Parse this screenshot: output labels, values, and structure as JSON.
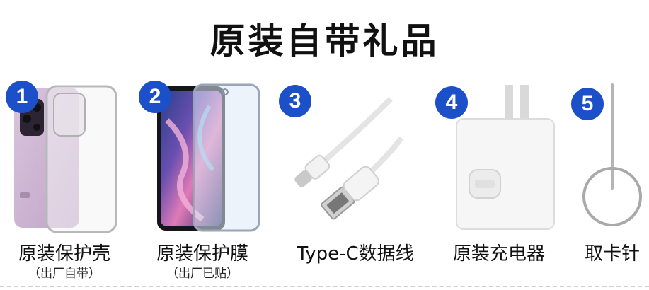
{
  "title": "原装自带礼品",
  "colors": {
    "badge": "#1b50c8",
    "text": "#111111"
  },
  "items": [
    {
      "number": "1",
      "label": "原装保护壳",
      "note": "（出厂自带）",
      "icon": "phone-case-icon"
    },
    {
      "number": "2",
      "label": "原装保护膜",
      "note": "（出厂已贴）",
      "icon": "screen-protector-icon"
    },
    {
      "number": "3",
      "label": "Type-C数据线",
      "note": "",
      "icon": "usb-cable-icon"
    },
    {
      "number": "4",
      "label": "原装充电器",
      "note": "",
      "icon": "charger-icon"
    },
    {
      "number": "5",
      "label": "取卡针",
      "note": "",
      "icon": "sim-ejector-pin-icon"
    }
  ]
}
